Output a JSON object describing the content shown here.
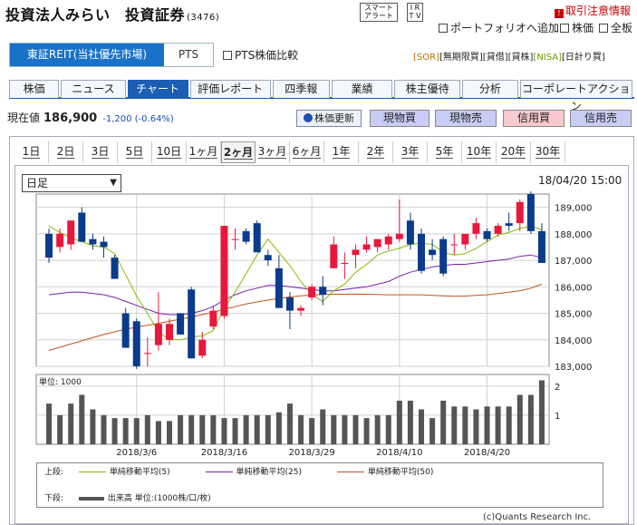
{
  "header": {
    "title": "投資法人みらい　投資証券",
    "code": "(3476)",
    "smart_alert": "スマート\nアラート",
    "ir_tv": "I R\nT V",
    "torihiki_label": "取引注意情報",
    "torihiki_icon": "!",
    "portfolio_link": "ポートフォリオへ追加",
    "kabuka_link": "株価",
    "zengara_link": "全板"
  },
  "market_tabs": {
    "primary": "東証REIT(当社優先市場)",
    "secondary": "PTS"
  },
  "pts_compare": "PTS株価比較",
  "badges": [
    {
      "label": "[SOR]",
      "color": "#c07000"
    },
    {
      "label": "[無期限買]",
      "color": "#222222"
    },
    {
      "label": "[貸借]",
      "color": "#222222"
    },
    {
      "label": "[貸株]",
      "color": "#222222"
    },
    {
      "label": "[NISA]",
      "color": "#6a9a00"
    },
    {
      "label": "[日計り買]",
      "color": "#222222"
    }
  ],
  "nav": [
    {
      "label": "株価",
      "active": false
    },
    {
      "label": "ニュース",
      "active": false
    },
    {
      "label": "チャート",
      "active": true
    },
    {
      "label": "評価レポート",
      "active": false
    },
    {
      "label": "四季報",
      "active": false
    },
    {
      "label": "業績",
      "active": false
    },
    {
      "label": "株主優待",
      "active": false
    },
    {
      "label": "分析",
      "active": false
    },
    {
      "label": "コーポレートアクション",
      "active": false
    }
  ],
  "price": {
    "label": "現在値",
    "value": "186,900",
    "change": "-1,200 (-0.64%)"
  },
  "buttons": {
    "refresh": "株価更新",
    "genbutsu_buy": "現物買",
    "genbutsu_sell": "現物売",
    "shinyo_buy": "信用買",
    "shinyo_sell": "信用売"
  },
  "periods": [
    {
      "num": "1",
      "unit": "日",
      "active": false
    },
    {
      "num": "2",
      "unit": "日",
      "active": false
    },
    {
      "num": "3",
      "unit": "日",
      "active": false
    },
    {
      "num": "5",
      "unit": "日",
      "active": false
    },
    {
      "num": "10",
      "unit": "日",
      "active": false
    },
    {
      "num": "1",
      "unit": "ヶ月",
      "active": false
    },
    {
      "num": "2",
      "unit": "ヶ月",
      "active": true
    },
    {
      "num": "3",
      "unit": "ヶ月",
      "active": false
    },
    {
      "num": "6",
      "unit": "ヶ月",
      "active": false
    },
    {
      "num": "1",
      "unit": "年",
      "active": false
    },
    {
      "num": "2",
      "unit": "年",
      "active": false
    },
    {
      "num": "3",
      "unit": "年",
      "active": false
    },
    {
      "num": "5",
      "unit": "年",
      "active": false
    },
    {
      "num": "10",
      "unit": "年",
      "active": false
    },
    {
      "num": "20",
      "unit": "年",
      "active": false
    },
    {
      "num": "30",
      "unit": "年",
      "active": false
    }
  ],
  "interval_select": "日足",
  "timestamp": "18/04/20 15:00",
  "chart_data": {
    "type": "candlestick",
    "ylim": [
      183000,
      189500
    ],
    "yticks": [
      "189,000",
      "188,000",
      "187,000",
      "186,000",
      "185,000",
      "184,000",
      "183,000"
    ],
    "ytick_values": [
      189000,
      188000,
      187000,
      186000,
      185000,
      184000,
      183000
    ],
    "xtick_labels": [
      "2018/3/6",
      "2018/3/16",
      "2018/3/29",
      "2018/4/10",
      "2018/4/20"
    ],
    "xtick_index": [
      8,
      16,
      24,
      32,
      40
    ],
    "colors": {
      "up": "#e8183c",
      "down": "#0a3b8c",
      "ma5": "#8ab800",
      "ma25": "#7a1fb0",
      "ma50": "#c8501a"
    },
    "candles": [
      {
        "o": 188000,
        "h": 188200,
        "l": 186900,
        "c": 187100
      },
      {
        "o": 187500,
        "h": 188200,
        "l": 187300,
        "c": 188000
      },
      {
        "o": 187600,
        "h": 188500,
        "l": 187400,
        "c": 188500
      },
      {
        "o": 188800,
        "h": 189000,
        "l": 187700,
        "c": 187700
      },
      {
        "o": 187800,
        "h": 188000,
        "l": 187400,
        "c": 187600
      },
      {
        "o": 187700,
        "h": 187900,
        "l": 187100,
        "c": 187500
      },
      {
        "o": 187100,
        "h": 187200,
        "l": 186300,
        "c": 186300
      },
      {
        "o": 185000,
        "h": 185200,
        "l": 183700,
        "c": 183700
      },
      {
        "o": 184700,
        "h": 184800,
        "l": 182900,
        "c": 183000
      },
      {
        "o": 183500,
        "h": 184100,
        "l": 183000,
        "c": 183500
      },
      {
        "o": 183800,
        "h": 185800,
        "l": 183600,
        "c": 184600
      },
      {
        "o": 184000,
        "h": 184800,
        "l": 183800,
        "c": 184600
      },
      {
        "o": 185000,
        "h": 185000,
        "l": 184200,
        "c": 184200
      },
      {
        "o": 185900,
        "h": 186000,
        "l": 183300,
        "c": 183300
      },
      {
        "o": 183400,
        "h": 184300,
        "l": 183300,
        "c": 184000
      },
      {
        "o": 184500,
        "h": 185300,
        "l": 184400,
        "c": 185100
      },
      {
        "o": 184900,
        "h": 188300,
        "l": 184800,
        "c": 188300
      },
      {
        "o": 187800,
        "h": 188200,
        "l": 187400,
        "c": 187800
      },
      {
        "o": 188100,
        "h": 188200,
        "l": 187600,
        "c": 187700
      },
      {
        "o": 188400,
        "h": 188500,
        "l": 187300,
        "c": 187300
      },
      {
        "o": 187200,
        "h": 187400,
        "l": 186800,
        "c": 187000
      },
      {
        "o": 186700,
        "h": 187200,
        "l": 185800,
        "c": 185200
      },
      {
        "o": 185600,
        "h": 185800,
        "l": 184400,
        "c": 185100
      },
      {
        "o": 185100,
        "h": 185300,
        "l": 184900,
        "c": 185200
      },
      {
        "o": 185600,
        "h": 186100,
        "l": 185500,
        "c": 186000
      },
      {
        "o": 186000,
        "h": 186400,
        "l": 185300,
        "c": 185700
      },
      {
        "o": 186700,
        "h": 187900,
        "l": 186700,
        "c": 187600
      },
      {
        "o": 186900,
        "h": 187300,
        "l": 186300,
        "c": 186900
      },
      {
        "o": 187200,
        "h": 187600,
        "l": 186700,
        "c": 187400
      },
      {
        "o": 187400,
        "h": 187900,
        "l": 187300,
        "c": 187600
      },
      {
        "o": 187500,
        "h": 187800,
        "l": 187300,
        "c": 187800
      },
      {
        "o": 187600,
        "h": 188000,
        "l": 187400,
        "c": 187900
      },
      {
        "o": 187800,
        "h": 189300,
        "l": 187700,
        "c": 188000
      },
      {
        "o": 188500,
        "h": 188800,
        "l": 187400,
        "c": 187600
      },
      {
        "o": 188000,
        "h": 188200,
        "l": 186500,
        "c": 186600
      },
      {
        "o": 187400,
        "h": 187800,
        "l": 187000,
        "c": 187200
      },
      {
        "o": 187800,
        "h": 187900,
        "l": 186400,
        "c": 186500
      },
      {
        "o": 187600,
        "h": 188000,
        "l": 187200,
        "c": 187600
      },
      {
        "o": 187600,
        "h": 188000,
        "l": 187400,
        "c": 188000
      },
      {
        "o": 188000,
        "h": 188600,
        "l": 187800,
        "c": 188400
      },
      {
        "o": 188100,
        "h": 188200,
        "l": 187700,
        "c": 187800
      },
      {
        "o": 188000,
        "h": 188400,
        "l": 187900,
        "c": 188300
      },
      {
        "o": 188400,
        "h": 188800,
        "l": 188100,
        "c": 188300
      },
      {
        "o": 188400,
        "h": 189300,
        "l": 188100,
        "c": 189200
      },
      {
        "o": 189500,
        "h": 189600,
        "l": 188000,
        "c": 188100
      },
      {
        "o": 188100,
        "h": 188400,
        "l": 186900,
        "c": 186900
      }
    ],
    "ma5": [
      188300,
      188050,
      187850,
      187700,
      187550,
      187500,
      187250,
      186450,
      185650,
      185000,
      184300,
      184000,
      184000,
      184100,
      184150,
      184350,
      185200,
      185800,
      186500,
      187200,
      187800,
      187300,
      186800,
      186200,
      185700,
      185450,
      185850,
      186100,
      186550,
      186850,
      187200,
      187350,
      187450,
      187600,
      187650,
      187600,
      187300,
      187200,
      187250,
      187450,
      187700,
      187950,
      188050,
      188200,
      188300,
      188150
    ],
    "ma25": [
      185700,
      185750,
      185800,
      185800,
      185750,
      185700,
      185600,
      185450,
      185300,
      185150,
      185000,
      184950,
      184950,
      185000,
      185100,
      185250,
      185500,
      185700,
      185850,
      185950,
      186050,
      186050,
      186000,
      185950,
      185900,
      185850,
      185850,
      185900,
      185950,
      186000,
      186100,
      186200,
      186400,
      186550,
      186650,
      186750,
      186800,
      186850,
      186850,
      186900,
      186950,
      187000,
      187050,
      187150,
      187200,
      187100
    ],
    "ma50": [
      183600,
      183720,
      183840,
      183960,
      184080,
      184200,
      184300,
      184400,
      184480,
      184550,
      184620,
      184700,
      184780,
      184860,
      184950,
      185050,
      185150,
      185250,
      185350,
      185430,
      185500,
      185560,
      185620,
      185660,
      185690,
      185710,
      185720,
      185720,
      185720,
      185720,
      185710,
      185700,
      185700,
      185700,
      185700,
      185680,
      185660,
      185640,
      185650,
      185680,
      185700,
      185750,
      185800,
      185850,
      185950,
      186100
    ],
    "volume": {
      "label": "単位: 1000",
      "yticks": [
        "2",
        "1"
      ],
      "ytick_values": [
        2,
        1
      ],
      "values": [
        1.4,
        1.0,
        1.4,
        1.7,
        1.2,
        1.0,
        0.9,
        0.9,
        0.9,
        1.0,
        0.8,
        0.8,
        1.0,
        1.0,
        1.0,
        1.0,
        0.9,
        0.9,
        1.0,
        1.0,
        1.0,
        1.1,
        1.4,
        1.0,
        0.9,
        1.2,
        1.0,
        1.0,
        1.0,
        0.9,
        1.0,
        1.0,
        1.5,
        1.5,
        1.2,
        0.9,
        1.5,
        1.3,
        1.3,
        1.2,
        1.3,
        1.3,
        1.3,
        1.7,
        1.7,
        2.2
      ]
    },
    "legend": {
      "upper_label": "上段:",
      "lower_label": "下段:",
      "ma5": "単純移動平均(5)",
      "ma25": "単純移動平均(25)",
      "ma50": "単純移動平均(50)",
      "volume": "出来高 単位:(1000株/口/枚)"
    }
  },
  "copyright": "(c)Quants Research Inc."
}
